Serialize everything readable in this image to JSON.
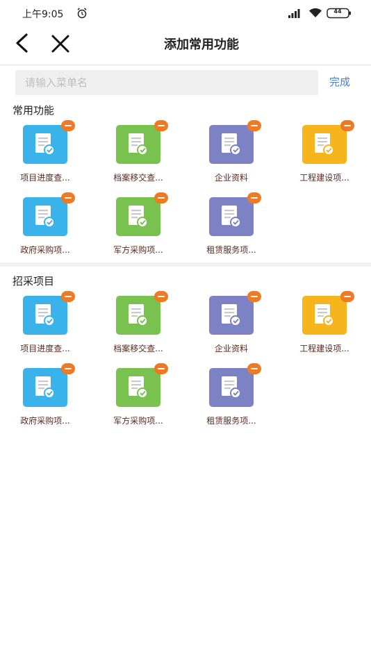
{
  "status": {
    "time": "上午9:05",
    "battery": "44",
    "icons": [
      "alarm-icon",
      "signal-icon",
      "wifi-icon",
      "battery-icon"
    ]
  },
  "nav": {
    "title": "添加常用功能",
    "icons": [
      "back-icon",
      "close-icon"
    ]
  },
  "search": {
    "placeholder": "请输入菜单名",
    "done_label": "完成"
  },
  "colors": {
    "blue": "#3ab2ea",
    "green": "#79c24f",
    "purple": "#7c82c4",
    "yellow": "#f6b51c",
    "badge": "#f07a22",
    "accent": "#3d83d8"
  },
  "sections": [
    {
      "title": "常用功能",
      "items": [
        {
          "label": "项目进度查...",
          "color": "blue"
        },
        {
          "label": "档案移交查...",
          "color": "green"
        },
        {
          "label": "企业资料",
          "color": "purple"
        },
        {
          "label": "工程建设项...",
          "color": "yellow"
        },
        {
          "label": "政府采购项...",
          "color": "blue"
        },
        {
          "label": "军方采购项...",
          "color": "green"
        },
        {
          "label": "租赁服务项...",
          "color": "purple"
        }
      ]
    },
    {
      "title": "招采项目",
      "items": [
        {
          "label": "项目进度查...",
          "color": "blue"
        },
        {
          "label": "档案移交查...",
          "color": "green"
        },
        {
          "label": "企业资料",
          "color": "purple"
        },
        {
          "label": "工程建设项...",
          "color": "yellow"
        },
        {
          "label": "政府采购项...",
          "color": "blue"
        },
        {
          "label": "军方采购项...",
          "color": "green"
        },
        {
          "label": "租赁服务项...",
          "color": "purple"
        }
      ]
    }
  ]
}
